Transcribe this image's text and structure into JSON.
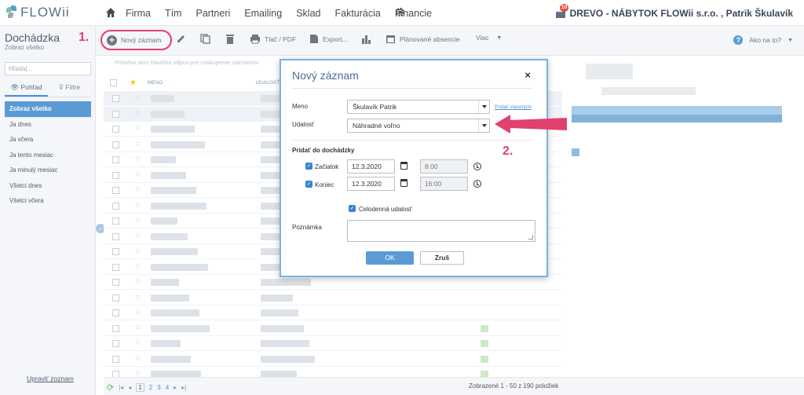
{
  "app": {
    "logo": "FLOWii"
  },
  "nav": [
    "Firma",
    "Tím",
    "Partneri",
    "Emailing",
    "Sklad",
    "Fakturácia",
    "Financie"
  ],
  "company": {
    "name": "DREVO - NÁBYTOK FLOWii s.r.o. , Patrik Škulavík",
    "badge": "10"
  },
  "sidebar": {
    "title": "Dochádzka",
    "subtitle": "Zobraz všetko",
    "search_placeholder": "Hľadaj...",
    "tabs": {
      "view": "Pohľad",
      "filter": "Filtre"
    },
    "items": [
      "Zobraz všetko",
      "Ja dnes",
      "Ja včera",
      "Ja tento mesiac",
      "Ja minulý mesiac",
      "Všetci dnes",
      "Všetci včera"
    ],
    "footer": "Upraviť zoznam"
  },
  "toolbar": {
    "new": "Nový záznam",
    "print": "Tlač / PDF",
    "export": "Export...",
    "planned": "Plánované absencie",
    "more": "Viac",
    "help": "Ako na to?"
  },
  "steps": {
    "one": "1.",
    "two": "2."
  },
  "table": {
    "hint": "Potiahni sem hlavičku stĺpca pre zoskupenie záznamov",
    "headers": {
      "name": "MENO",
      "event": "UDALOSŤ"
    }
  },
  "status": {
    "pages": [
      "1",
      "2",
      "3",
      "4"
    ],
    "count": "Zobrazené 1 - 50 z 190 položiek"
  },
  "dialog": {
    "title": "Nový záznam",
    "close": "×",
    "name_label": "Meno",
    "name_value": "Škulavík Patrik",
    "add_more_link": "Pridať viacerých",
    "event_label": "Udalosť",
    "event_value": "Náhradné voľno",
    "section_title": "Pridať do dochádzky",
    "start_label": "Začiatok",
    "start_date": "12.3.2020",
    "start_time": "8:00",
    "end_label": "Koniec",
    "end_date": "12.3.2020",
    "end_time": "16:00",
    "allday_label": "Celodenná udalosť",
    "note_label": "Poznámka",
    "ok": "OK",
    "cancel": "Zruš"
  },
  "colors": {
    "accent": "#5b9bd5",
    "highlight": "#e1416d",
    "dialog_border": "#7ab2e2"
  }
}
